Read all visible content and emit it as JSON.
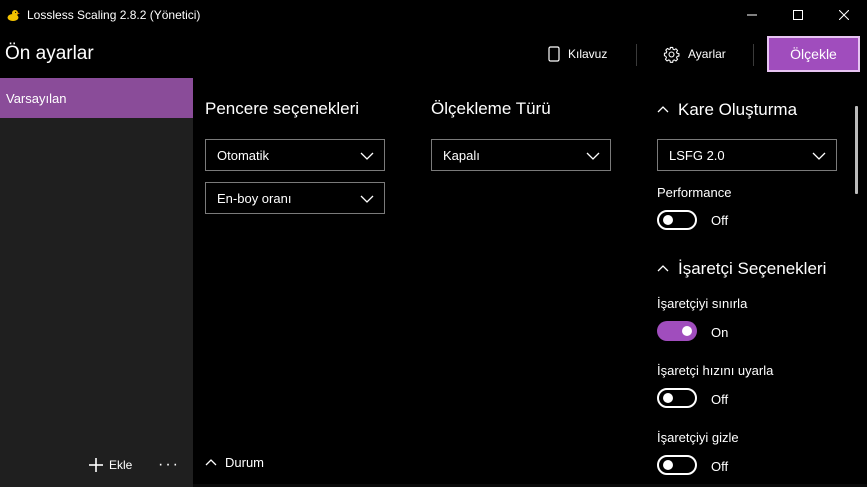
{
  "window": {
    "title": "Lossless Scaling 2.8.2 (Yönetici)",
    "icon": "duck-icon",
    "controls": [
      "minimize-icon",
      "maximize-icon",
      "close-icon"
    ]
  },
  "header": {
    "title": "Ön ayarlar",
    "guide_label": "Kılavuz",
    "settings_label": "Ayarlar",
    "scale_label": "Ölçekle"
  },
  "sidebar": {
    "items": [
      {
        "label": "Varsayılan",
        "selected": true
      }
    ],
    "add_label": "Ekle",
    "more_label": "···"
  },
  "window_options": {
    "title": "Pencere seçenekleri",
    "mode": "Otomatik",
    "aspect": "En-boy oranı"
  },
  "scaling": {
    "title": "Ölçekleme Türü",
    "type": "Kapalı"
  },
  "status": {
    "label": "Durum"
  },
  "frame_gen": {
    "title": "Kare Oluşturma",
    "mode": "LSFG 2.0",
    "performance_label": "Performance",
    "performance_state": "Off"
  },
  "cursor": {
    "title": "İşaretçi Seçenekleri",
    "limit_label": "İşaretçiyi sınırla",
    "limit_state": "On",
    "adapt_label": "İşaretçi hızını uyarla",
    "adapt_state": "Off",
    "hide_label": "İşaretçiyi gizle",
    "hide_state": "Off"
  },
  "colors": {
    "accent": "#a04dbd",
    "selected_item": "#8a4c99",
    "sidebar_bg": "#1f1f1f",
    "background": "#000000"
  }
}
